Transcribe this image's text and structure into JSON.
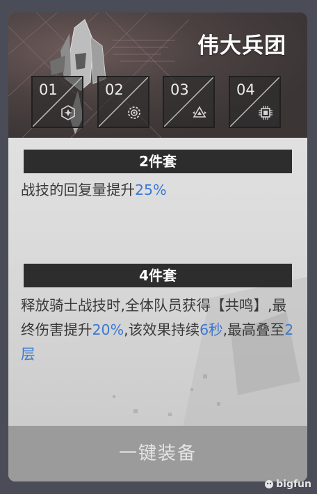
{
  "header": {
    "title": "伟大兵团"
  },
  "slots": [
    {
      "number": "01",
      "icon": "hexagon-star-icon"
    },
    {
      "number": "02",
      "icon": "gear-target-icon"
    },
    {
      "number": "03",
      "icon": "triangle-arrows-icon"
    },
    {
      "number": "04",
      "icon": "chip-icon"
    }
  ],
  "sets": [
    {
      "heading": "2件套",
      "desc": [
        {
          "t": "战技的回复量提升"
        },
        {
          "t": "25%",
          "hl": true
        }
      ]
    },
    {
      "heading": "4件套",
      "desc": [
        {
          "t": "释放骑士战技时,全体队员获得【共鸣】,最终伤害提升"
        },
        {
          "t": "20%",
          "hl": true
        },
        {
          "t": ",该效果持续"
        },
        {
          "t": "6秒",
          "hl": true
        },
        {
          "t": ",最高叠至"
        },
        {
          "t": "2层",
          "hl": true
        }
      ]
    }
  ],
  "footer": {
    "equip_label": "一键装备"
  },
  "watermark": {
    "text": "bigfun"
  },
  "colors": {
    "highlight": "#3a78d6",
    "bar": "#2d2d2d",
    "button": "#9b9b9b"
  }
}
